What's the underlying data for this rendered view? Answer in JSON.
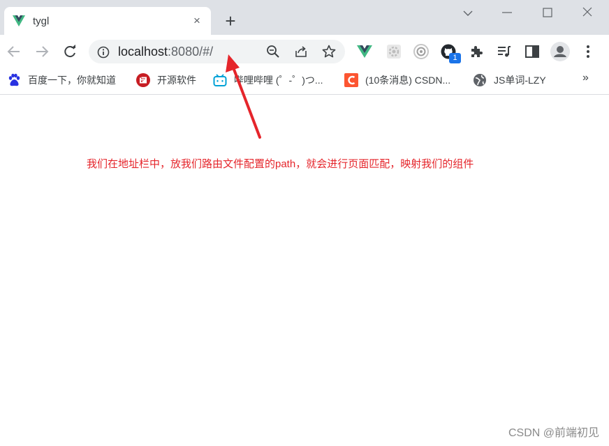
{
  "tab": {
    "title": "tygl",
    "favicon": "vue-logo-icon",
    "close": "×"
  },
  "new_tab": "+",
  "window_controls": {
    "chevron": "chevron-down-icon",
    "minimize": "minimize-icon",
    "maximize": "maximize-icon",
    "close": "close-icon"
  },
  "address_bar": {
    "host": "localhost",
    "rest": ":8080/#/"
  },
  "extensions": {
    "github_badge": "1"
  },
  "bookmarks": [
    {
      "label": "百度一下，你就知道",
      "icon": "baidu-paw-icon"
    },
    {
      "label": "开源软件",
      "icon": "gitee-icon"
    },
    {
      "label": "哔哩哔哩 (゜-゜)つ...",
      "icon": "bilibili-icon"
    },
    {
      "label": "(10条消息) CSDN...",
      "icon": "csdn-icon"
    },
    {
      "label": "JS单词-LZY",
      "icon": "globe-icon"
    }
  ],
  "bookmarks_more": "»",
  "annotation": "我们在地址栏中，放我们路由文件配置的path，就会进行页面匹配，映射我们的组件",
  "watermark": "CSDN @前端初见",
  "colors": {
    "annotation": "#e5252b",
    "tabstrip": "#dee1e6",
    "omnibox": "#f1f3f4",
    "badge": "#1a73e8"
  }
}
